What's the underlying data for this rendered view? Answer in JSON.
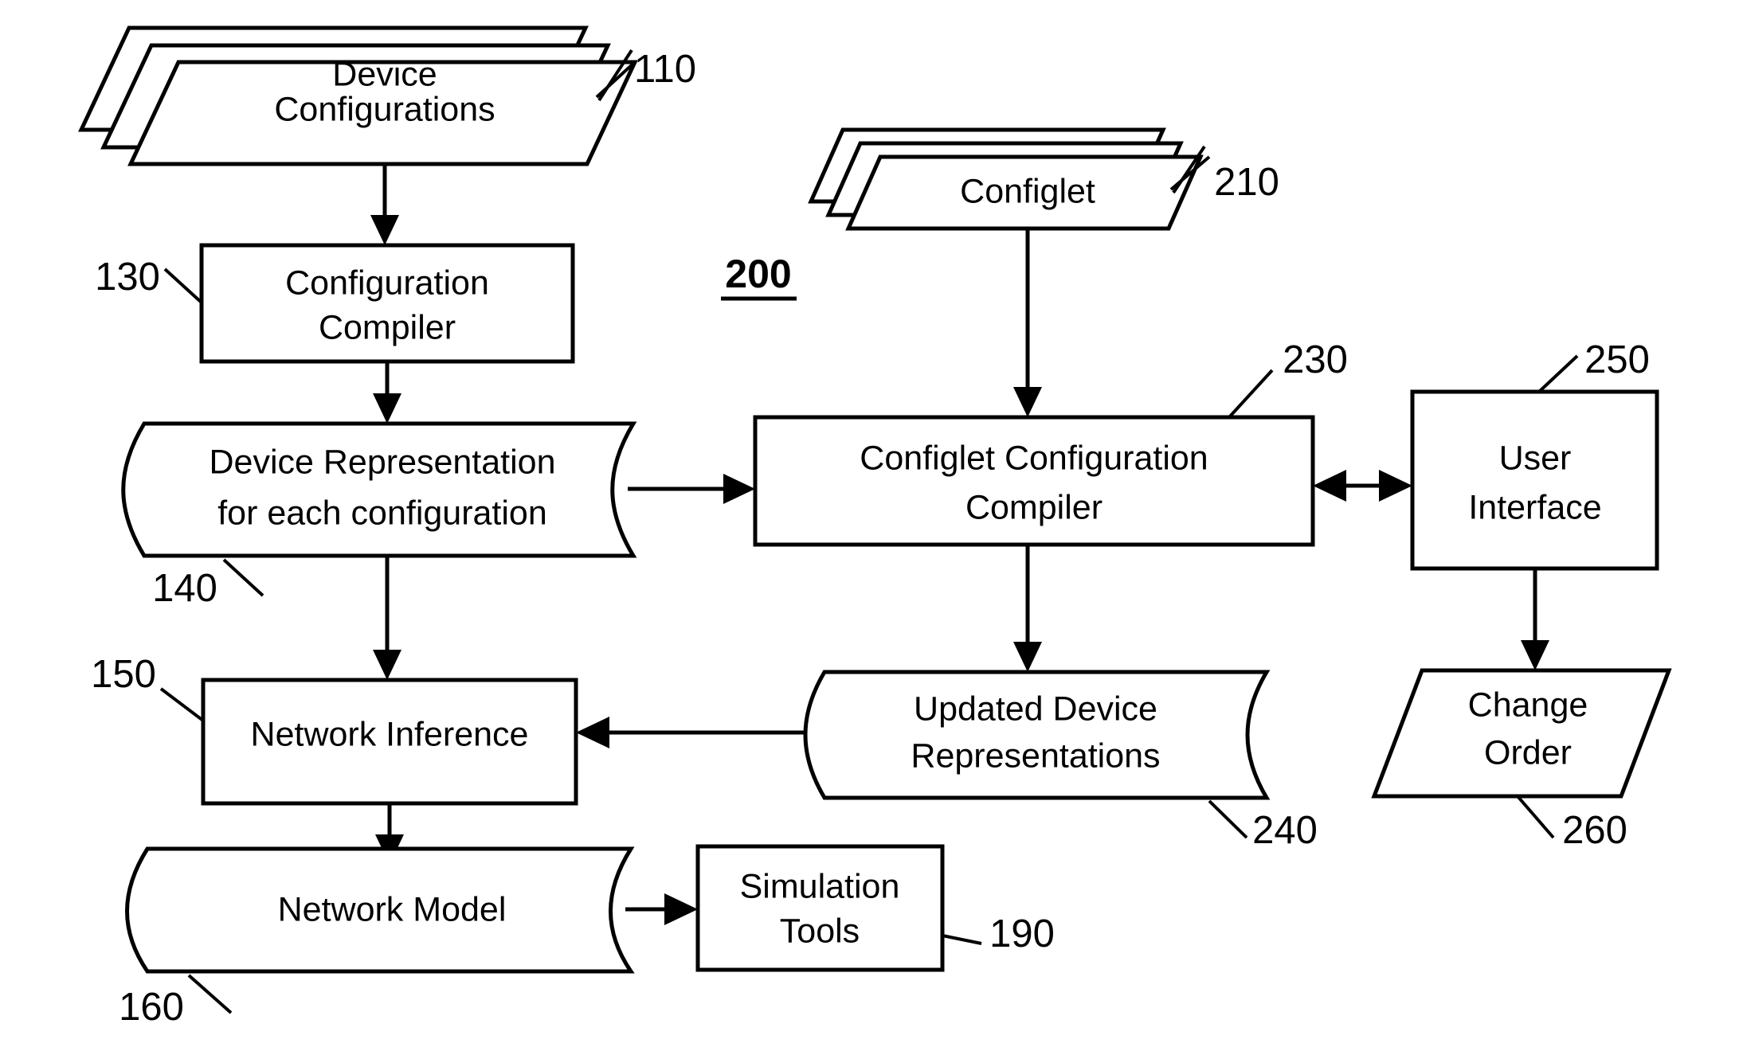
{
  "figure": {
    "number": "200",
    "title": "Network configuration compiler flow diagram"
  },
  "nodes": {
    "device_configurations": {
      "label_line1": "Device",
      "label_line2": "Configurations",
      "ref": "110",
      "shape": "stacked-parallelogram"
    },
    "configuration_compiler": {
      "label_line1": "Configuration",
      "label_line2": "Compiler",
      "ref": "130",
      "shape": "rectangle"
    },
    "device_representation": {
      "label_line1": "Device Representation",
      "label_line2": "for each configuration",
      "ref": "140",
      "shape": "data-tape"
    },
    "network_inference": {
      "label_line1": "Network Inference",
      "label_line2": "",
      "ref": "150",
      "shape": "rectangle"
    },
    "network_model": {
      "label_line1": "Network Model",
      "label_line2": "",
      "ref": "160",
      "shape": "data-tape"
    },
    "simulation_tools": {
      "label_line1": "Simulation",
      "label_line2": "Tools",
      "ref": "190",
      "shape": "rectangle"
    },
    "configlet": {
      "label_line1": "Configlet",
      "label_line2": "",
      "ref": "210",
      "shape": "stacked-parallelogram"
    },
    "configlet_configuration_compiler": {
      "label_line1": "Configlet Configuration",
      "label_line2": "Compiler",
      "ref": "230",
      "shape": "rectangle"
    },
    "updated_device_representations": {
      "label_line1": "Updated Device",
      "label_line2": "Representations",
      "ref": "240",
      "shape": "data-tape"
    },
    "user_interface": {
      "label_line1": "User",
      "label_line2": "Interface",
      "ref": "250",
      "shape": "rectangle"
    },
    "change_order": {
      "label_line1": "Change",
      "label_line2": "Order",
      "ref": "260",
      "shape": "parallelogram"
    }
  },
  "edges": [
    {
      "from": "device_configurations",
      "to": "configuration_compiler",
      "direction": "down"
    },
    {
      "from": "configuration_compiler",
      "to": "device_representation",
      "direction": "down"
    },
    {
      "from": "device_representation",
      "to": "network_inference",
      "direction": "down"
    },
    {
      "from": "device_representation",
      "to": "configlet_configuration_compiler",
      "direction": "right"
    },
    {
      "from": "network_inference",
      "to": "network_model",
      "direction": "down"
    },
    {
      "from": "network_model",
      "to": "simulation_tools",
      "direction": "right"
    },
    {
      "from": "configlet",
      "to": "configlet_configuration_compiler",
      "direction": "down"
    },
    {
      "from": "configlet_configuration_compiler",
      "to": "user_interface",
      "direction": "bidirectional"
    },
    {
      "from": "configlet_configuration_compiler",
      "to": "updated_device_representations",
      "direction": "down"
    },
    {
      "from": "updated_device_representations",
      "to": "network_inference",
      "direction": "left"
    },
    {
      "from": "user_interface",
      "to": "change_order",
      "direction": "down"
    }
  ],
  "colors": {
    "stroke": "#000000",
    "fill": "#ffffff",
    "background": "#ffffff"
  }
}
